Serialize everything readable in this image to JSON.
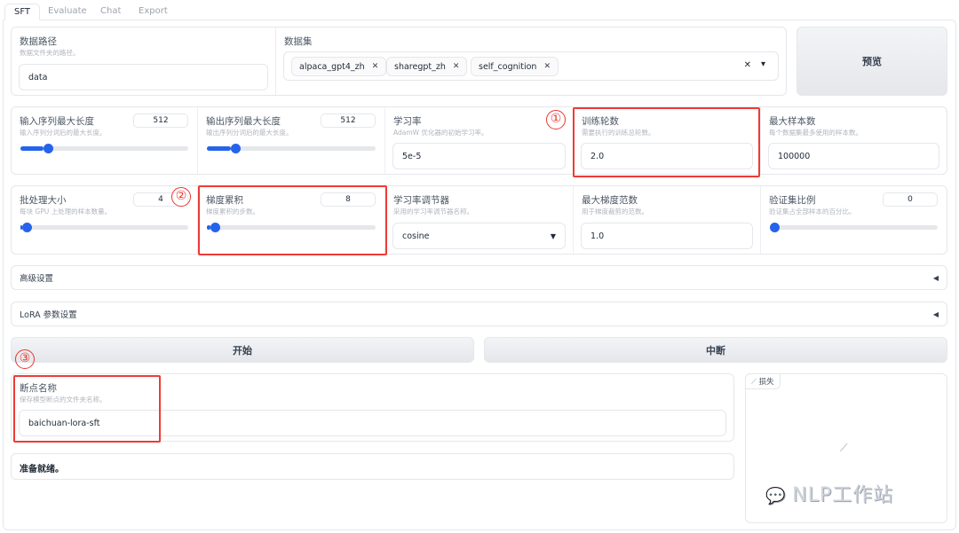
{
  "tabs": [
    "SFT",
    "Evaluate",
    "Chat",
    "Export"
  ],
  "data_path": {
    "label": "数据路径",
    "desc": "数据文件夹的路径。",
    "value": "data"
  },
  "dataset": {
    "label": "数据集",
    "tags": [
      "alpaca_gpt4_zh",
      "sharegpt_zh",
      "self_cognition"
    ],
    "clear_icon": "✕",
    "dropdown_icon": "▾"
  },
  "preview_button": "预览",
  "row2": [
    {
      "label": "输入序列最大长度",
      "desc": "输入序列分词后的最大长度。",
      "value": "512",
      "fraction": 0.14
    },
    {
      "label": "输出序列最大长度",
      "desc": "输出序列分词后的最大长度。",
      "value": "512",
      "fraction": 0.14
    },
    {
      "label": "学习率",
      "desc": "AdamW 优化器的初始学习率。",
      "value": "5e-5"
    },
    {
      "label": "训练轮数",
      "desc": "需要执行的训练总轮数。",
      "value": "2.0"
    },
    {
      "label": "最大样本数",
      "desc": "每个数据集最多使用的样本数。",
      "value": "100000"
    }
  ],
  "row3": [
    {
      "label": "批处理大小",
      "desc": "每块 GPU 上处理的样本数量。",
      "value": "4",
      "fraction": 0.01
    },
    {
      "label": "梯度累积",
      "desc": "梯度累积的步数。",
      "value": "8",
      "fraction": 0.02
    },
    {
      "label": "学习率调节器",
      "desc": "采用的学习率调节器名称。",
      "value": "cosine"
    },
    {
      "label": "最大梯度范数",
      "desc": "用于梯度裁剪的范数。",
      "value": "1.0"
    },
    {
      "label": "验证集比例",
      "desc": "验证集占全部样本的百分比。",
      "value": "0",
      "fraction": 0
    }
  ],
  "advanced": "高级设置",
  "lora": "LoRA 参数设置",
  "start_button": "开始",
  "abort_button": "中断",
  "checkpoint": {
    "label": "断点名称",
    "desc": "保存模型断点的文件夹名称。",
    "value": "baichuan-lora-sft"
  },
  "status": "准备就绪。",
  "loss_plot": {
    "label": "损失"
  },
  "annotations": [
    "①",
    "②",
    "③"
  ],
  "watermark": "NLP工作站",
  "colors": {
    "accent": "#2563eb",
    "annotation": "#ef3b36"
  }
}
